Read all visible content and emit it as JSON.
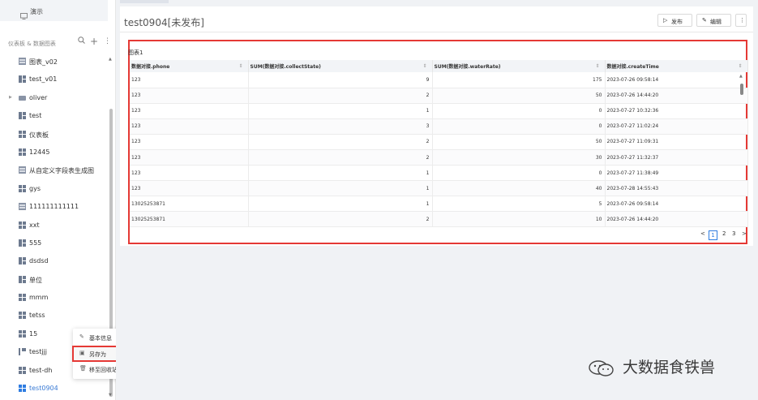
{
  "sidebar": {
    "top_item": {
      "icon": "monitor-icon",
      "label": "演示"
    },
    "section": {
      "title": "仪表板 & 数据图表",
      "search_icon": "search-icon",
      "add_icon": "plus-icon",
      "more_icon": "more-vertical-icon"
    },
    "items": [
      {
        "label": "图表_v02",
        "icon": "table-icon",
        "expandable": false
      },
      {
        "label": "test_v01",
        "icon": "dashboard-icon",
        "expandable": false
      },
      {
        "label": "oliver",
        "icon": "folder-icon",
        "expandable": true
      },
      {
        "label": "test",
        "icon": "dashboard-icon",
        "expandable": false
      },
      {
        "label": "仪表板",
        "icon": "dashboard-icon",
        "expandable": false
      },
      {
        "label": "12445",
        "icon": "dashboard-icon",
        "expandable": false
      },
      {
        "label": "从自定义字段表生成图",
        "icon": "table-icon",
        "expandable": false
      },
      {
        "label": "gys",
        "icon": "dashboard-icon",
        "expandable": false
      },
      {
        "label": "111111111111",
        "icon": "table-icon",
        "expandable": false
      },
      {
        "label": "xxt",
        "icon": "dashboard-icon",
        "expandable": false
      },
      {
        "label": "555",
        "icon": "dashboard-icon",
        "expandable": false
      },
      {
        "label": "dsdsd",
        "icon": "dashboard-icon",
        "expandable": false
      },
      {
        "label": "单位",
        "icon": "dashboard-icon",
        "expandable": false
      },
      {
        "label": "mmm",
        "icon": "dashboard-icon",
        "expandable": false
      },
      {
        "label": "tetss",
        "icon": "dashboard-icon",
        "expandable": false
      },
      {
        "label": "15",
        "icon": "dashboard-icon",
        "expandable": false
      },
      {
        "label": "testjjj",
        "icon": "flag-icon",
        "expandable": false
      },
      {
        "label": "test-dh",
        "icon": "dashboard-icon",
        "expandable": false
      },
      {
        "label": "test0904",
        "icon": "dashboard-icon",
        "expandable": false,
        "active": true
      }
    ]
  },
  "context_menu": {
    "items": [
      {
        "icon": "edit-icon",
        "label": "基本信息"
      },
      {
        "icon": "copy-icon",
        "label": "另存为",
        "highlighted": true
      },
      {
        "icon": "trash-icon",
        "label": "移至回收站"
      }
    ]
  },
  "main": {
    "title": "test0904[未发布]",
    "publish_label": "发布",
    "edit_label": "编辑",
    "more_label": "⋮",
    "chart_title": "图表1",
    "table": {
      "columns": [
        "数据对接.phone",
        "SUM(数据对接.collectState)",
        "SUM(数据对接.waterRate)",
        "数据对接.createTime"
      ],
      "rows": [
        [
          "123",
          "9",
          "175",
          "2023-07-26 09:58:14"
        ],
        [
          "123",
          "2",
          "50",
          "2023-07-26 14:44:20"
        ],
        [
          "123",
          "1",
          "0",
          "2023-07-27 10:32:36"
        ],
        [
          "123",
          "3",
          "0",
          "2023-07-27 11:02:24"
        ],
        [
          "123",
          "2",
          "50",
          "2023-07-27 11:09:31"
        ],
        [
          "123",
          "2",
          "30",
          "2023-07-27 11:32:37"
        ],
        [
          "123",
          "1",
          "0",
          "2023-07-27 11:38:49"
        ],
        [
          "123",
          "1",
          "40",
          "2023-07-28 14:55:43"
        ],
        [
          "13025253871",
          "1",
          "5",
          "2023-07-26 09:58:14"
        ],
        [
          "13025253871",
          "2",
          "10",
          "2023-07-26 14:44:20"
        ]
      ]
    },
    "pager": {
      "prev": "<",
      "pages": [
        "1",
        "2",
        "3"
      ],
      "current": "1",
      "next": ">"
    }
  },
  "watermark": {
    "text": "大数据食铁兽",
    "icon": "wechat-icon"
  },
  "colors": {
    "accent": "#2f7de1",
    "highlight_border": "#e53935"
  }
}
